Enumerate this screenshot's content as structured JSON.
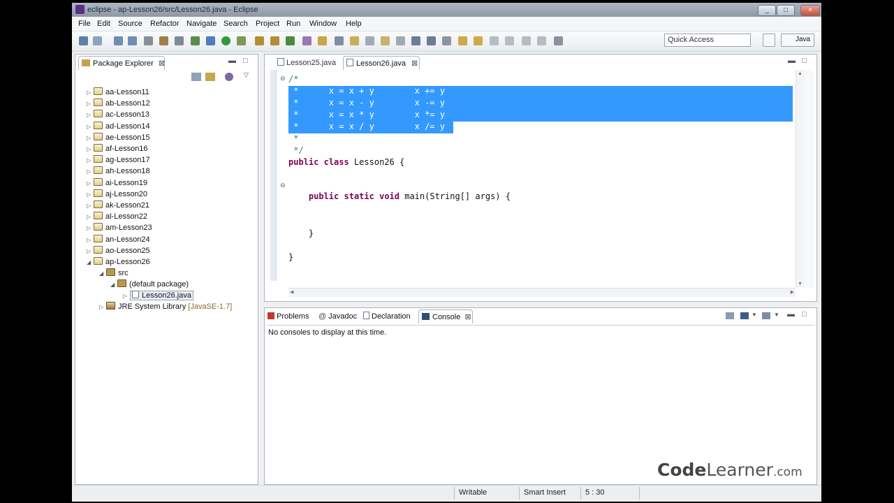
{
  "window": {
    "title": "eclipse - ap-Lesson26/src/Lesson26.java - Eclipse",
    "controls": [
      "_",
      "□",
      "×"
    ]
  },
  "menu": [
    "File",
    "Edit",
    "Source",
    "Refactor",
    "Navigate",
    "Search",
    "Project",
    "Run",
    "Window",
    "Help"
  ],
  "toolbar": {
    "quick_access_placeholder": "Quick Access",
    "perspective_label": "Java"
  },
  "package_explorer": {
    "title": "Package Explorer",
    "projects": [
      "aa-Lesson11",
      "ab-Lesson12",
      "ac-Lesson13",
      "ad-Lesson14",
      "ae-Lesson15",
      "af-Lesson16",
      "ag-Lesson17",
      "ah-Lesson18",
      "ai-Lesson19",
      "aj-Lesson20",
      "ak-Lesson21",
      "al-Lesson22",
      "am-Lesson23",
      "an-Lesson24",
      "ao-Lesson25",
      "ap-Lesson26"
    ],
    "src": "src",
    "default_package": "(default package)",
    "selected_file": "Lesson26.java",
    "jre": "JRE System Library",
    "jre_version": "[JavaSE-1.7]"
  },
  "editor": {
    "tabs": [
      "Lesson25.java",
      "Lesson26.java"
    ],
    "lines": [
      "/*",
      " *      x = x + y        x += y",
      " *      x = x - y        x -= y",
      " *      x = x * y        x *= y",
      " *      x = x / y        x /= y",
      " *",
      " */",
      "public class Lesson26 {",
      "",
      "    public static void main(String[] args) {",
      "",
      "",
      "    }",
      "",
      "}"
    ]
  },
  "bottom_panel": {
    "tabs": [
      "Problems",
      "Javadoc",
      "Declaration",
      "Console"
    ],
    "message": "No consoles to display at this time."
  },
  "status": {
    "writable": "Writable",
    "insert_mode": "Smart Insert",
    "position": "5 : 30"
  },
  "watermark": {
    "part1": "Code",
    "part2": "Learner",
    "part3": ".com"
  }
}
